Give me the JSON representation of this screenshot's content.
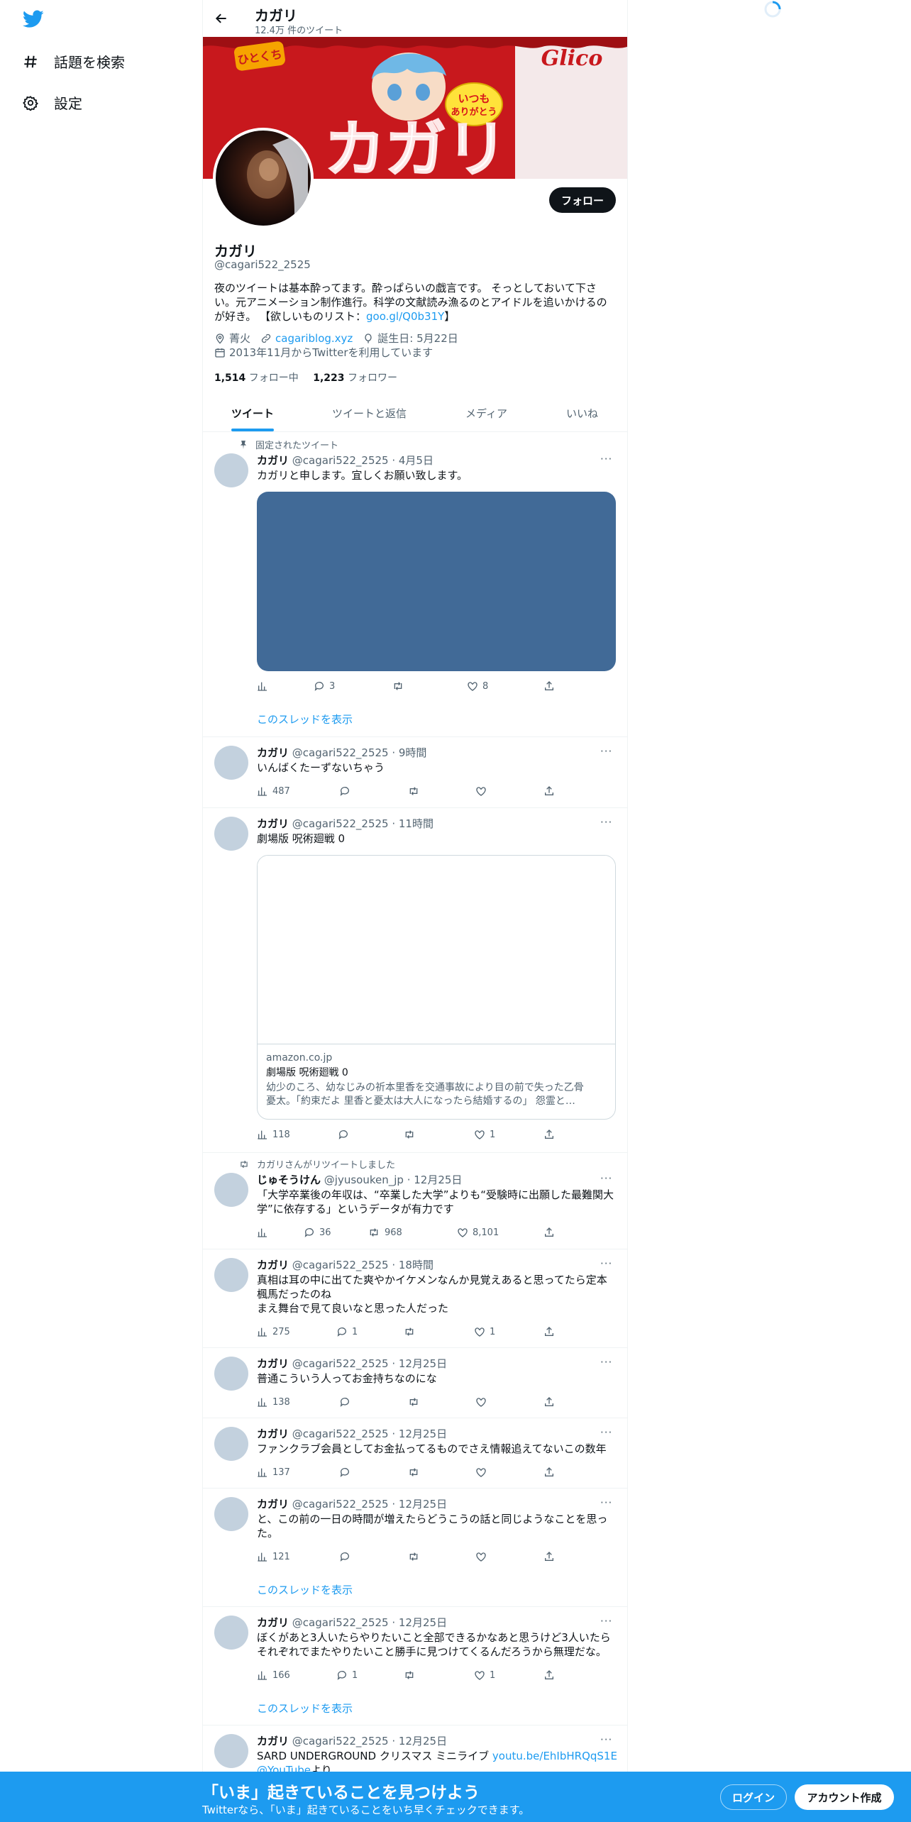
{
  "nav": {
    "explore": "話題を検索",
    "settings": "設定"
  },
  "header": {
    "name": "カガリ",
    "tweet_count": "12.4万 件のツイート"
  },
  "banner": {
    "badge": "ひとくち",
    "title": "カガリ",
    "bubble_line1": "いつも",
    "bubble_line2": "ありがとう",
    "brand": "Glico"
  },
  "profile": {
    "follow_label": "フォロー",
    "name": "カガリ",
    "handle": "@cagari522_2525",
    "bio_line1": "夜のツイートは基本酔ってます。酔っぱらいの戯言です。 そっとしておいて下さ",
    "bio_line2": "い。元アニメーション制作進行。科学の文献読み漁るのとアイドルを追いかけるの",
    "bio_line3_prefix": "が好き。 【欲しいものリスト：",
    "bio_link": "goo.gl/Q0b31Y",
    "bio_line3_suffix": "】",
    "location": "菁火",
    "website": "cagariblog.xyz",
    "birthday": "誕生日: 5月22日",
    "joined": "2013年11月からTwitterを利用しています",
    "following_count": "1,514",
    "following_label": "フォロー中",
    "followers_count": "1,223",
    "followers_label": "フォロワー"
  },
  "tabs": [
    "ツイート",
    "ツイートと返信",
    "メディア",
    "いいね"
  ],
  "thread_label": "このスレッドを表示",
  "more": "···",
  "tweets": [
    {
      "pinned": "固定されたツイート",
      "name": "カガリ",
      "meta": "@cagari522_2525 · 4月5日",
      "text": "カガリと申します。宜しくお願い致します。",
      "views": "",
      "replies": "3",
      "retweets": "",
      "likes": "8",
      "media_color": "#416a97"
    },
    {
      "name": "カガリ",
      "meta": "@cagari522_2525 · 9時間",
      "text": "いんばくたーずないちゃう",
      "views": "487",
      "replies": "",
      "retweets": "",
      "likes": ""
    },
    {
      "name": "カガリ",
      "meta": "@cagari522_2525 · 11時間",
      "text": "劇場版 呪術廻戦 0",
      "views": "118",
      "replies": "",
      "retweets": "",
      "likes": "1",
      "card_domain": "amazon.co.jp",
      "card_title": "劇場版 呪術廻戦 0",
      "card_desc1": "幼少のころ、幼なじみの祈本里香を交通事故により目の前で失った乙骨",
      "card_desc2": "憂太。「約束だよ 里香と憂太は大人になったら結婚するの」 怨霊と…"
    },
    {
      "retweeted_by": "カガリさんがリツイートしました",
      "name": "じゅそうけん",
      "meta": "@jyusouken_jp · 12月25日",
      "text1": "「大学卒業後の年収は、“卒業した大学”よりも“受験時に出願した最難関大",
      "text2": "学”に依存する」というデータが有力です",
      "views": "",
      "replies": "36",
      "retweets": "968",
      "likes": "8,101"
    },
    {
      "name": "カガリ",
      "meta": "@cagari522_2525 · 18時間",
      "text1": "真相は耳の中に出てた爽やかイケメンなんか見覚えあると思ってたら定本",
      "text2": "楓馬だったのね",
      "text3": "まえ舞台で見て良いなと思った人だった",
      "views": "275",
      "replies": "1",
      "retweets": "",
      "likes": "1"
    },
    {
      "name": "カガリ",
      "meta": "@cagari522_2525 · 12月25日",
      "text": "普通こういう人ってお金持ちなのにな",
      "views": "138",
      "replies": "",
      "retweets": "",
      "likes": ""
    },
    {
      "name": "カガリ",
      "meta": "@cagari522_2525 · 12月25日",
      "text": "ファンクラブ会員としてお金払ってるものでさえ情報追えてないこの数年",
      "views": "137",
      "replies": "",
      "retweets": "",
      "likes": ""
    },
    {
      "name": "カガリ",
      "meta": "@cagari522_2525 · 12月25日",
      "text1": "と、この前の一日の時間が増えたらどうこうの話と同じようなことを思っ",
      "text2": "た。",
      "views": "121",
      "replies": "",
      "retweets": "",
      "likes": ""
    },
    {
      "name": "カガリ",
      "meta": "@cagari522_2525 · 12月25日",
      "text1": "ぼくがあと3人いたらやりたいこと全部できるかなあと思うけど3人いたら",
      "text2": "それぞれでまたやりたいこと勝手に見つけてくるんだろうから無理だな。",
      "views": "166",
      "replies": "1",
      "retweets": "",
      "likes": "1"
    },
    {
      "name": "カガリ",
      "meta": "@cagari522_2525 · 12月25日",
      "text_prefix": "SARD UNDERGROUND クリスマス ミニライブ ",
      "text_link": "youtu.be/EhIbHRQqS1E",
      "text2_link": "@YouTube",
      "text2_suffix": "より"
    }
  ],
  "bottom": {
    "title": "「いま」起きていることを見つけよう",
    "subtitle": "Twitterなら、「いま」起きていることをいち早くチェックできます。",
    "login": "ログイン",
    "signup": "アカウント作成"
  },
  "colors": {
    "accent": "#1d9bf0",
    "bottom_bar": "#1d9bf0"
  }
}
